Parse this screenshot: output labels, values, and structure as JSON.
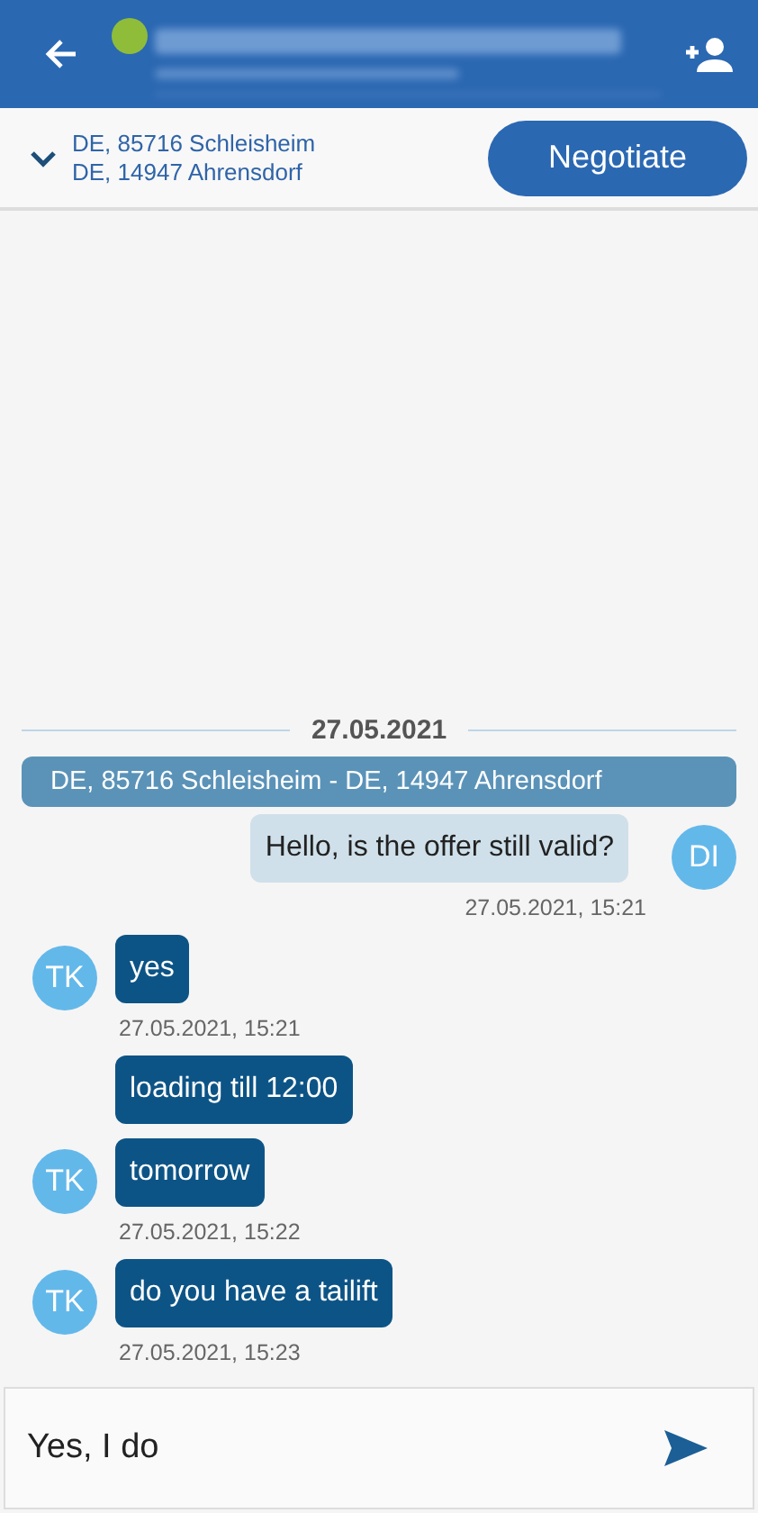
{
  "header": {
    "online": true
  },
  "route": {
    "from": "DE, 85716 Schleisheim",
    "to": "DE, 14947 Ahrensdorf",
    "expanded": false,
    "button": "Negotiate"
  },
  "chat": {
    "date": "27.05.2021",
    "banner": "DE, 85716 Schleisheim - DE, 14947 Ahrensdorf",
    "messages": [
      {
        "kind": "outgoing",
        "initials": "DI",
        "text": "Hello, is the offer still valid?",
        "time": "27.05.2021, 15:21"
      },
      {
        "kind": "incoming",
        "initials": "TK",
        "text": "yes",
        "time": "27.05.2021, 15:21"
      },
      {
        "kind": "incoming",
        "text": "loading till 12:00"
      },
      {
        "kind": "incoming",
        "initials": "TK",
        "text": "tomorrow",
        "time": "27.05.2021, 15:22"
      },
      {
        "kind": "incoming",
        "initials": "TK",
        "text": "do you have a tailift",
        "time": "27.05.2021, 15:23"
      }
    ]
  },
  "composer": {
    "value": "Yes, I do"
  }
}
